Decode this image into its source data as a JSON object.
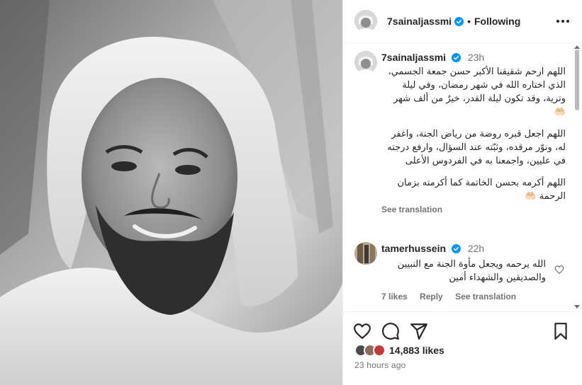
{
  "post": {
    "author": {
      "username": "7sainaljassmi",
      "verified": true,
      "follow_status": "Following",
      "separator": "•"
    },
    "caption": {
      "username": "7sainaljassmi",
      "time": "23h",
      "paragraphs": [
        "اللهم ارحم شقيقنا الأكبر حسن جمعة الجسمي، الذي اختاره الله في شهر رمضان، وفي ليلة وترية، وقد تكون ليلة القدر، خيرٌ من ألف شهر 🤲🏻",
        "اللهم اجعل قبره روضة من رياض الجنة، واغفر له، ونوّر مرقده، وثبّته عند السؤال، وارفع درجته في عليين، واجمعنا به في الفردوس الأعلى",
        "اللهم أكرمه بحسن الخاتمة كما أكرمته بزمان الرحمة 🤲🏻"
      ],
      "see_translation": "See translation"
    },
    "comments": [
      {
        "username": "tamerhussein",
        "verified": true,
        "time": "22h",
        "text": "الله يرحمه ويجعل مأوة الجنة مع النبيين والصديقين والشهداء أمين",
        "likes_label": "7 likes",
        "reply_label": "Reply",
        "see_translation": "See translation"
      }
    ],
    "likes": {
      "count_label": "14,883 likes"
    },
    "posted_ago": "23 hours ago",
    "icons": {
      "like": "heart-icon",
      "comment": "comment-icon",
      "share": "share-icon",
      "save": "bookmark-icon",
      "more": "more-horizontal-icon",
      "verified": "verified-badge-icon"
    },
    "colors": {
      "verified_blue": "#0095f6",
      "muted_text": "#737373",
      "text": "#262626"
    }
  }
}
